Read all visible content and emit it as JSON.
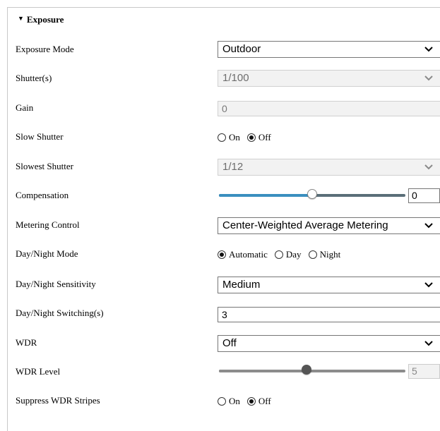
{
  "section": {
    "title": "Exposure"
  },
  "exposure_mode": {
    "label": "Exposure Mode",
    "value": "Outdoor"
  },
  "shutter": {
    "label": "Shutter(s)",
    "value": "1/100"
  },
  "gain": {
    "label": "Gain",
    "value": "0"
  },
  "slow_shutter": {
    "label": "Slow Shutter",
    "on_label": "On",
    "off_label": "Off",
    "selected": "Off"
  },
  "slowest_shutter": {
    "label": "Slowest Shutter",
    "value": "1/12"
  },
  "compensation": {
    "label": "Compensation",
    "value": "0",
    "level": 0.5
  },
  "metering_control": {
    "label": "Metering Control",
    "value": "Center-Weighted Average Metering"
  },
  "day_night_mode": {
    "label": "Day/Night Mode",
    "options": [
      "Automatic",
      "Day",
      "Night"
    ],
    "selected": "Automatic"
  },
  "day_night_sensitivity": {
    "label": "Day/Night Sensitivity",
    "value": "Medium"
  },
  "day_night_switching": {
    "label": "Day/Night Switching(s)",
    "value": "3"
  },
  "wdr": {
    "label": "WDR",
    "value": "Off"
  },
  "wdr_level": {
    "label": "WDR Level",
    "value": "5",
    "level": 0.47
  },
  "suppress_wdr_stripes": {
    "label": "Suppress WDR Stripes",
    "on_label": "On",
    "off_label": "Off",
    "selected": "Off"
  },
  "colors": {
    "slider_fill": "#3a8fbf",
    "slider_track": "#5a6e78",
    "border": "#767676",
    "disabled_bg": "#f2f2f2"
  }
}
